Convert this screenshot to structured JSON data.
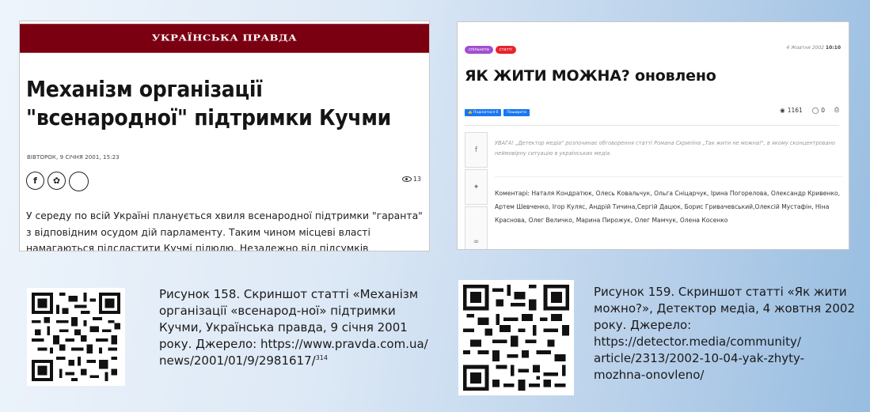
{
  "left_article": {
    "masthead": "УКРАЇНСЬКА ПРАВДА",
    "title": "Механізм організації \"всенародної\" підтримки Кучми",
    "date": "ВІВТОРОК, 9 СІЧНЯ 2001, 15:23",
    "share_icons": [
      "facebook-icon",
      "twitter-icon",
      "comment-icon"
    ],
    "views": "13",
    "body": "У середу по всій Україні планується хвиля всенародної підтримки \"гаранта\" з відповідним осудом дій парламенту. Таким чином місцеві власті намагаються підсластити Кучмі пілюлю. Незалежно від підсумків експертизи тіла, знайденого у Таращі (ми все ще сподіваємося, що її"
  },
  "right_article": {
    "tags": [
      "спільнота",
      "статті"
    ],
    "date": "4 Жовтня 2002",
    "time": "10:10",
    "title": "ЯК ЖИТИ МОЖНА? оновлено",
    "fb_buttons": [
      "Поділитися 0",
      "Поширити"
    ],
    "stats": {
      "views": "1161",
      "comments": "0"
    },
    "side_icons": [
      "facebook-icon",
      "twitter-icon",
      "link-icon"
    ],
    "note": "УВАГА! „Детектор медіа\" розпочинає обговорення статті Романа Скрипіна „Так жити не можна!\", в якому сконцентровано неймовірну ситуацію в українських медіа.",
    "comments": "Коментарі: Наталя Кондратюк, Олесь Ковальчук, Ольга Сніцарчук, Ірина Погорелова, Олександр Кривенко, Артем Шевченко, Ігор Куляс, Андрій Тичина,Сергій Дацюк, Борис Гривачевський,Олексій Мустафін, Ніна Краснова, Олег Величко, Марина Пирожук, Олег Мамчук, Олена Косенко"
  },
  "captions": [
    {
      "text": "Рисунок 158. Скриншот статті «Механізм організації «всенарод-ної» підтримки Кучми, Українська правда, 9 січня 2001 року. Джерело: https://www.pravda.com.ua/ news/2001/01/9/2981617/",
      "footnote": "314"
    },
    {
      "text": "Рисунок 159. Скриншот статті «Як жити можно?», Детектор медіа, 4 жовтня 2002 року. Джерело: https://detector.media/community/ article/2313/2002-10-04-yak-zhyty-mozhna-onovleno/"
    }
  ]
}
